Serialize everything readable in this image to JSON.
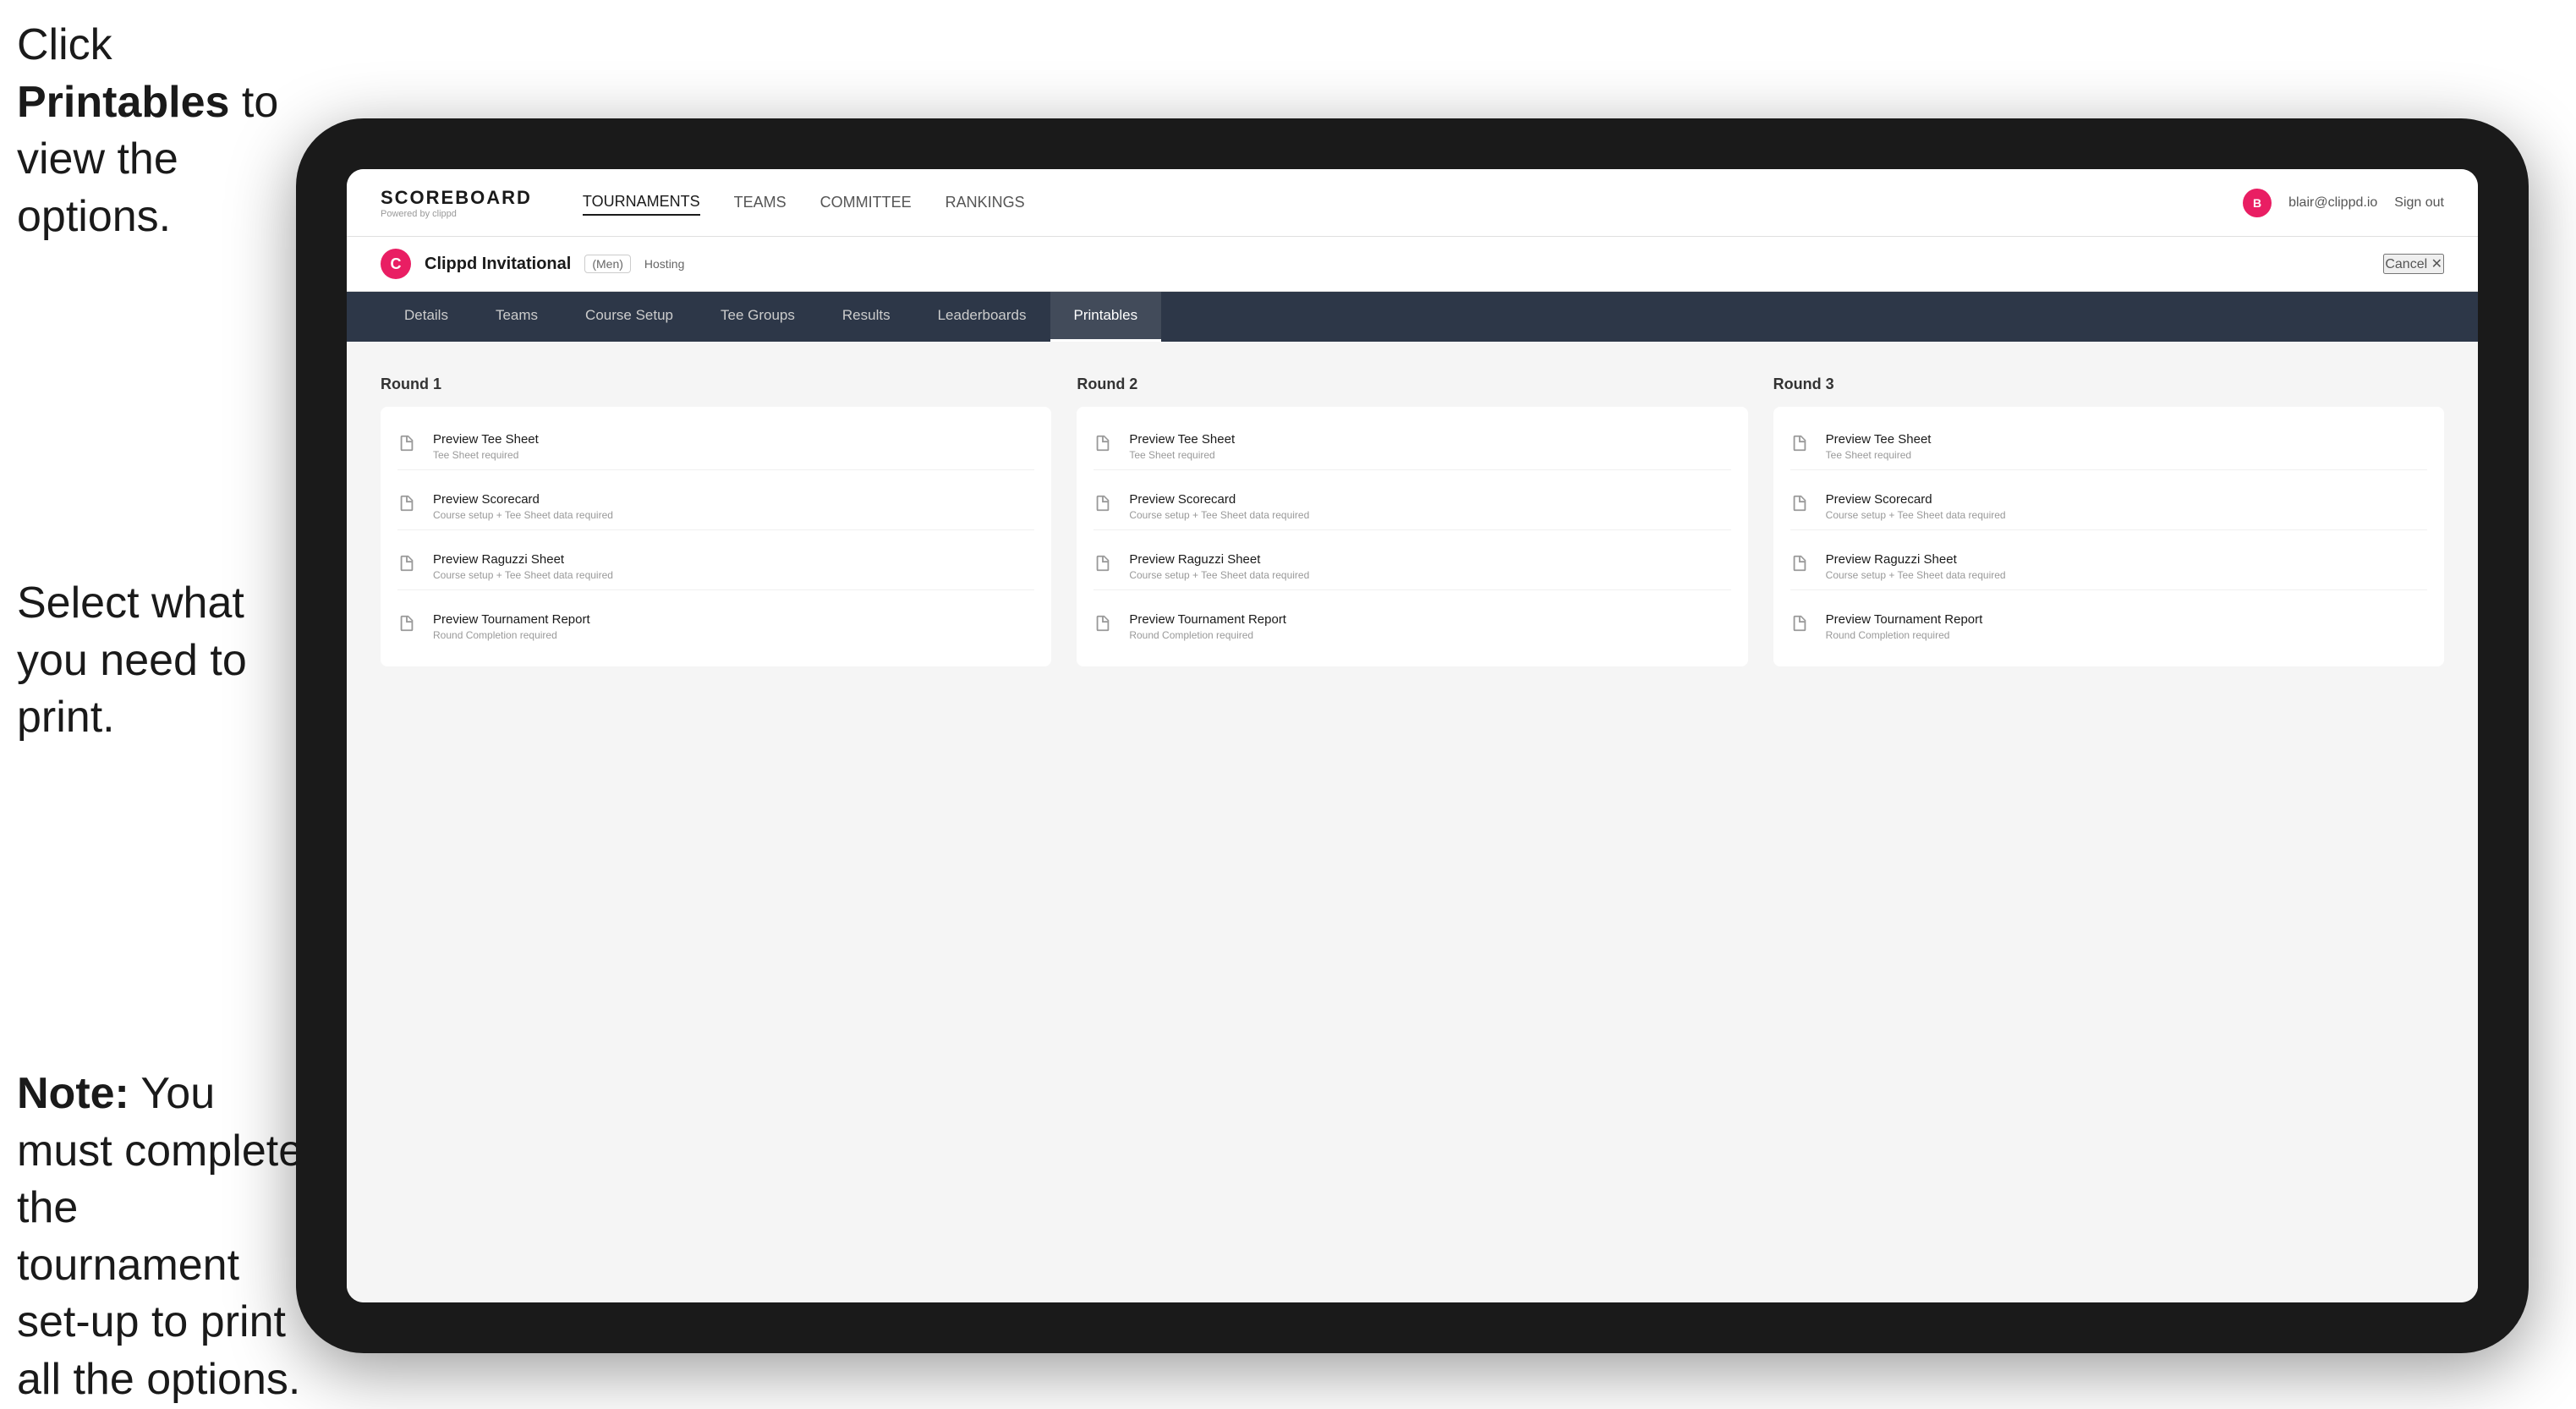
{
  "annotations": {
    "top": {
      "prefix": "Click ",
      "bold": "Printables",
      "suffix": " to view the options."
    },
    "middle": "Select what you need to print.",
    "bottom": {
      "prefix_bold": "Note:",
      "suffix": " You must complete the tournament set-up to print all the options."
    }
  },
  "nav": {
    "logo_title": "SCOREBOARD",
    "logo_subtitle": "Powered by clippd",
    "links": [
      "TOURNAMENTS",
      "TEAMS",
      "COMMITTEE",
      "RANKINGS"
    ],
    "user_email": "blair@clippd.io",
    "sign_out": "Sign out"
  },
  "sub_header": {
    "tournament_initial": "C",
    "tournament_name": "Clippd Invitational",
    "badge": "(Men)",
    "hosting": "Hosting",
    "cancel": "Cancel ✕"
  },
  "tabs": [
    {
      "label": "Details"
    },
    {
      "label": "Teams"
    },
    {
      "label": "Course Setup"
    },
    {
      "label": "Tee Groups"
    },
    {
      "label": "Results"
    },
    {
      "label": "Leaderboards"
    },
    {
      "label": "Printables",
      "active": true
    }
  ],
  "rounds": [
    {
      "title": "Round 1",
      "items": [
        {
          "name": "Preview Tee Sheet",
          "req": "Tee Sheet required"
        },
        {
          "name": "Preview Scorecard",
          "req": "Course setup + Tee Sheet data required"
        },
        {
          "name": "Preview Raguzzi Sheet",
          "req": "Course setup + Tee Sheet data required"
        },
        {
          "name": "Preview Tournament Report",
          "req": "Round Completion required"
        }
      ]
    },
    {
      "title": "Round 2",
      "items": [
        {
          "name": "Preview Tee Sheet",
          "req": "Tee Sheet required"
        },
        {
          "name": "Preview Scorecard",
          "req": "Course setup + Tee Sheet data required"
        },
        {
          "name": "Preview Raguzzi Sheet",
          "req": "Course setup + Tee Sheet data required"
        },
        {
          "name": "Preview Tournament Report",
          "req": "Round Completion required"
        }
      ]
    },
    {
      "title": "Round 3",
      "items": [
        {
          "name": "Preview Tee Sheet",
          "req": "Tee Sheet required"
        },
        {
          "name": "Preview Scorecard",
          "req": "Course setup + Tee Sheet data required"
        },
        {
          "name": "Preview Raguzzi Sheet",
          "req": "Course setup + Tee Sheet data required"
        },
        {
          "name": "Preview Tournament Report",
          "req": "Round Completion required"
        }
      ]
    }
  ],
  "colors": {
    "accent": "#e91e63",
    "nav_bg": "#2d3748",
    "arrow_color": "#e91e63"
  }
}
